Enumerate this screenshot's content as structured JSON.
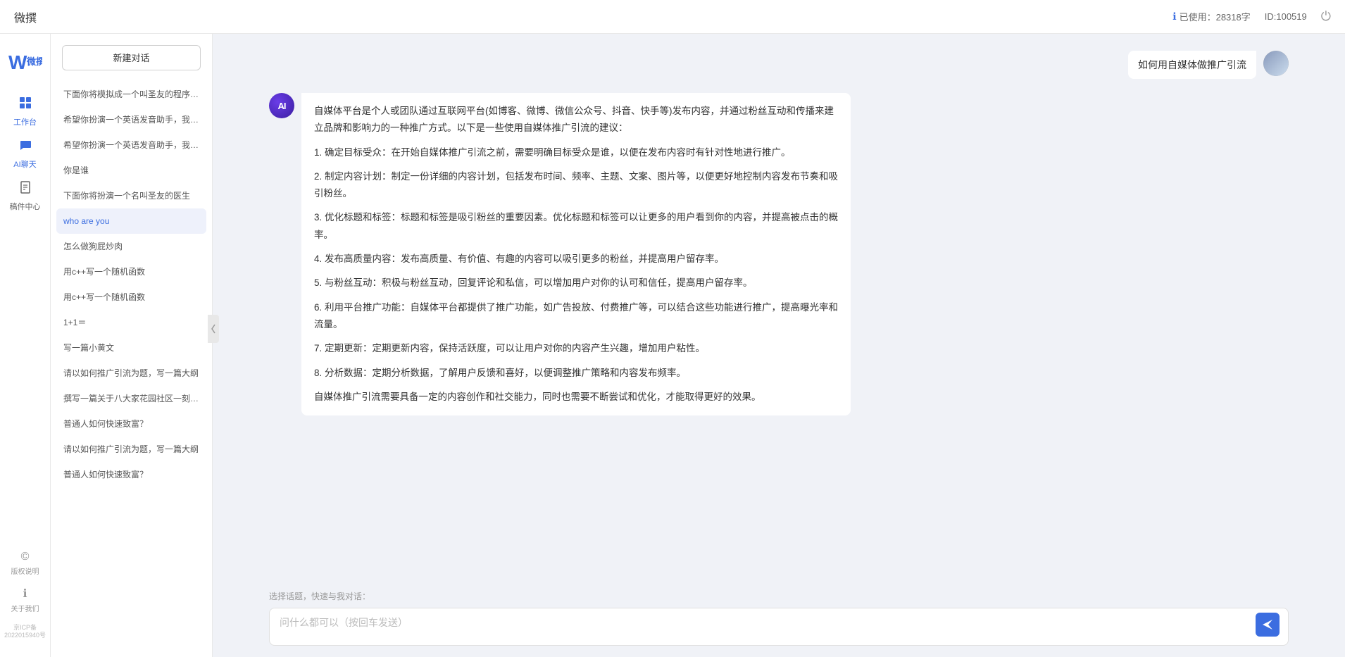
{
  "topbar": {
    "title": "微撰",
    "usage_label": "已使用：28318字",
    "usage_icon": "info-icon",
    "id_label": "ID:100519",
    "logout_icon": "power-icon"
  },
  "left_nav": {
    "logo_text": "W 微撰",
    "items": [
      {
        "id": "workbench",
        "label": "工作台",
        "icon": "🖥"
      },
      {
        "id": "ai-chat",
        "label": "AI聊天",
        "icon": "💬",
        "active": true
      },
      {
        "id": "mailbox",
        "label": "稿件中心",
        "icon": "📄"
      }
    ],
    "bottom_items": [
      {
        "id": "copyright",
        "label": "版权说明",
        "icon": "©"
      },
      {
        "id": "about",
        "label": "关于我们",
        "icon": "ℹ"
      }
    ],
    "icp": "京ICP备2022015940号"
  },
  "sidebar": {
    "new_chat_label": "新建对话",
    "items": [
      {
        "id": 1,
        "text": "下面你将模拟成一个叫圣友的程序员，我说...",
        "active": false
      },
      {
        "id": 2,
        "text": "希望你扮演一个英语发音助手，我提供给你...",
        "active": false
      },
      {
        "id": 3,
        "text": "希望你扮演一个英语发音助手，我提供给你...",
        "active": false
      },
      {
        "id": 4,
        "text": "你是谁",
        "active": false
      },
      {
        "id": 5,
        "text": "下面你将扮演一个名叫圣友的医生",
        "active": false
      },
      {
        "id": 6,
        "text": "who are you",
        "active": true
      },
      {
        "id": 7,
        "text": "怎么做狗屁炒肉",
        "active": false
      },
      {
        "id": 8,
        "text": "用c++写一个随机函数",
        "active": false
      },
      {
        "id": 9,
        "text": "用c++写一个随机函数",
        "active": false
      },
      {
        "id": 10,
        "text": "1+1＝",
        "active": false
      },
      {
        "id": 11,
        "text": "写一篇小黄文",
        "active": false
      },
      {
        "id": 12,
        "text": "请以如何推广引流为题，写一篇大纲",
        "active": false
      },
      {
        "id": 13,
        "text": "撰写一篇关于八大家花园社区一刻钟便民生...",
        "active": false
      },
      {
        "id": 14,
        "text": "普通人如何快速致富？",
        "active": false
      },
      {
        "id": 15,
        "text": "请以如何推广引流为题，写一篇大纲",
        "active": false
      },
      {
        "id": 16,
        "text": "普通人如何快速致富？",
        "active": false
      }
    ]
  },
  "chat": {
    "messages": [
      {
        "type": "user",
        "text": "如何用自媒体做推广引流"
      },
      {
        "type": "ai",
        "paragraphs": [
          "自媒体平台是个人或团队通过互联网平台(如博客、微博、微信公众号、抖音、快手等)发布内容，并通过粉丝互动和传播来建立品牌和影响力的一种推广方式。以下是一些使用自媒体推广引流的建议：",
          "1. 确定目标受众：在开始自媒体推广引流之前，需要明确目标受众是谁，以便在发布内容时有针对性地进行推广。",
          "2. 制定内容计划：制定一份详细的内容计划，包括发布时间、频率、主题、文案、图片等，以便更好地控制内容发布节奏和吸引粉丝。",
          "3. 优化标题和标签：标题和标签是吸引粉丝的重要因素。优化标题和标签可以让更多的用户看到你的内容，并提高被点击的概率。",
          "4. 发布高质量内容：发布高质量、有价值、有趣的内容可以吸引更多的粉丝，并提高用户留存率。",
          "5. 与粉丝互动：积极与粉丝互动，回复评论和私信，可以增加用户对你的认可和信任，提高用户留存率。",
          "6. 利用平台推广功能：自媒体平台都提供了推广功能，如广告投放、付费推广等，可以结合这些功能进行推广，提高曝光率和流量。",
          "7. 定期更新：定期更新内容，保持活跃度，可以让用户对你的内容产生兴趣，增加用户粘性。",
          "8. 分析数据：定期分析数据，了解用户反馈和喜好，以便调整推广策略和内容发布频率。",
          "自媒体推广引流需要具备一定的内容创作和社交能力，同时也需要不断尝试和优化，才能取得更好的效果。"
        ]
      }
    ],
    "quick_topic_label": "选择话题，快速与我对话：",
    "input_placeholder": "问什么都可以（按回车发送）",
    "send_icon": "send-icon"
  }
}
